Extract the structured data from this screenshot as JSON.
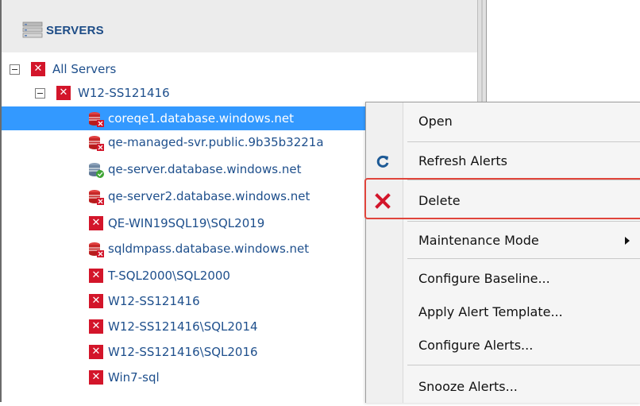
{
  "panel": {
    "title": "SERVERS"
  },
  "tree": {
    "root": {
      "label": "All Servers"
    },
    "group": {
      "label": "W12-SS121416"
    },
    "items": [
      {
        "label": "coreqe1.database.windows.net",
        "icon": "database-alert-icon",
        "selected": true
      },
      {
        "label": "qe-managed-svr.public.9b35b3221a",
        "icon": "database-alert-icon"
      },
      {
        "label": "qe-server.database.windows.net",
        "icon": "database-ok-icon"
      },
      {
        "label": "qe-server2.database.windows.net",
        "icon": "database-alert-icon"
      },
      {
        "label": "QE-WIN19SQL19\\SQL2019",
        "icon": "error-x-icon"
      },
      {
        "label": "sqldmpass.database.windows.net",
        "icon": "database-alert-icon"
      },
      {
        "label": "T-SQL2000\\SQL2000",
        "icon": "error-x-icon"
      },
      {
        "label": "W12-SS121416",
        "icon": "error-x-icon"
      },
      {
        "label": "W12-SS121416\\SQL2014",
        "icon": "error-x-icon"
      },
      {
        "label": "W12-SS121416\\SQL2016",
        "icon": "error-x-icon"
      },
      {
        "label": "Win7-sql",
        "icon": "error-x-icon"
      }
    ]
  },
  "menu": {
    "items": [
      {
        "label": "Open"
      },
      {
        "label": "Refresh Alerts",
        "icon": "refresh-icon"
      },
      {
        "label": "Delete",
        "icon": "delete-x-icon",
        "highlighted": true
      },
      {
        "label": "Maintenance Mode",
        "submenu": true
      },
      {
        "label": "Configure Baseline..."
      },
      {
        "label": "Apply Alert Template..."
      },
      {
        "label": "Configure Alerts..."
      },
      {
        "label": "Snooze Alerts..."
      }
    ]
  },
  "colors": {
    "selection": "#3399ff",
    "tree_text": "#1e4f8c",
    "error_red": "#d3152a",
    "highlight_border": "#e0443b",
    "header_bg": "#ececec"
  }
}
